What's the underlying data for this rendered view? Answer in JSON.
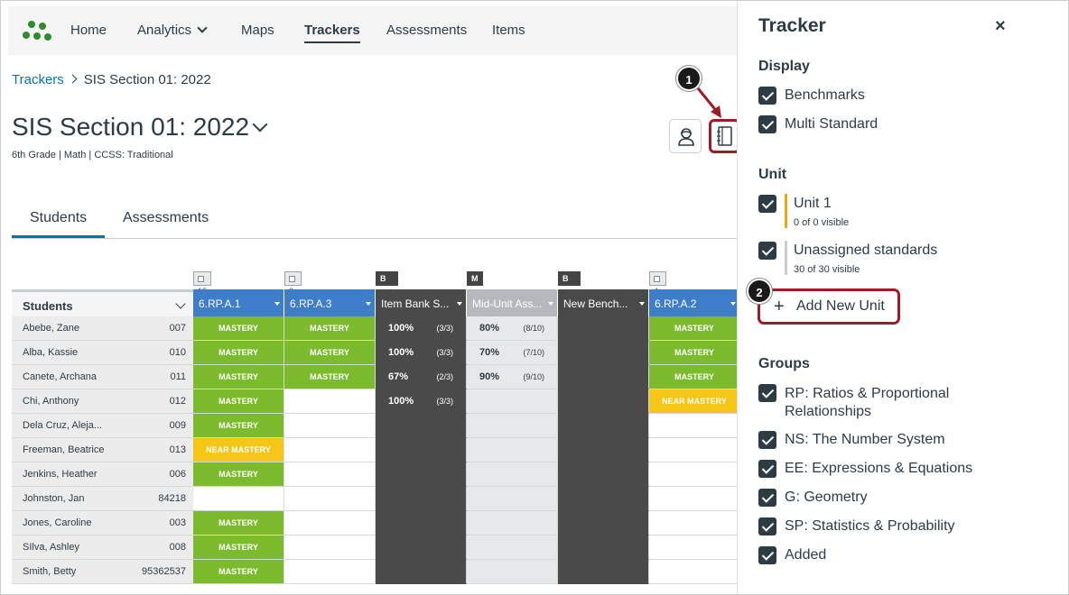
{
  "nav": {
    "items": [
      "Home",
      "Analytics",
      "Maps",
      "Trackers",
      "Assessments",
      "Items"
    ],
    "active": "Trackers"
  },
  "breadcrumb": {
    "root": "Trackers",
    "current": "SIS Section 01: 2022"
  },
  "page": {
    "title": "SIS Section 01: 2022",
    "subtitle": "6th Grade | Math | CCSS: Traditional"
  },
  "callouts": {
    "one": "1",
    "two": "2"
  },
  "tabs": [
    "Students",
    "Assessments"
  ],
  "grid": {
    "students_header": "Students",
    "tags": [
      "15",
      "3",
      "B",
      "M",
      "B",
      "4"
    ],
    "columns": [
      "6.RP.A.1",
      "6.RP.A.3",
      "Item Bank S...",
      "Mid-Unit Ass...",
      "New Bench...",
      "6.RP.A.2"
    ],
    "rows": [
      {
        "name": "Abebe, Zane",
        "id": "007",
        "c1": "MASTERY",
        "c2": "MASTERY",
        "c3": "100%",
        "c3f": "(3/3)",
        "c4": "80%",
        "c4f": "(8/10)",
        "c6": "MASTERY"
      },
      {
        "name": "Alba, Kassie",
        "id": "010",
        "c1": "MASTERY",
        "c2": "MASTERY",
        "c3": "100%",
        "c3f": "(3/3)",
        "c4": "70%",
        "c4f": "(7/10)",
        "c6": "MASTERY"
      },
      {
        "name": "Canete, Archana",
        "id": "011",
        "c1": "MASTERY",
        "c2": "MASTERY",
        "c3": "67%",
        "c3f": "(2/3)",
        "c4": "90%",
        "c4f": "(9/10)",
        "c6": "MASTERY"
      },
      {
        "name": "Chi, Anthony",
        "id": "012",
        "c1": "MASTERY",
        "c2": "",
        "c3": "100%",
        "c3f": "(3/3)",
        "c4": "",
        "c4f": "",
        "c6": "NEAR MASTERY"
      },
      {
        "name": "Dela Cruz, Aleja...",
        "id": "009",
        "c1": "MASTERY",
        "c2": "",
        "c3": "",
        "c3f": "",
        "c4": "",
        "c4f": "",
        "c6": ""
      },
      {
        "name": "Freeman, Beatrice",
        "id": "013",
        "c1": "NEAR MASTERY",
        "c2": "",
        "c3": "",
        "c3f": "",
        "c4": "",
        "c4f": "",
        "c6": ""
      },
      {
        "name": "Jenkins, Heather",
        "id": "006",
        "c1": "MASTERY",
        "c2": "",
        "c3": "",
        "c3f": "",
        "c4": "",
        "c4f": "",
        "c6": ""
      },
      {
        "name": "Johnston, Jan",
        "id": "84218",
        "c1": "",
        "c2": "",
        "c3": "",
        "c3f": "",
        "c4": "",
        "c4f": "",
        "c6": ""
      },
      {
        "name": "Jones, Caroline",
        "id": "003",
        "c1": "MASTERY",
        "c2": "",
        "c3": "",
        "c3f": "",
        "c4": "",
        "c4f": "",
        "c6": ""
      },
      {
        "name": "SIlva, Ashley",
        "id": "008",
        "c1": "MASTERY",
        "c2": "",
        "c3": "",
        "c3f": "",
        "c4": "",
        "c4f": "",
        "c6": ""
      },
      {
        "name": "Smith, Betty",
        "id": "95362537",
        "c1": "MASTERY",
        "c2": "",
        "c3": "",
        "c3f": "",
        "c4": "",
        "c4f": "",
        "c6": ""
      }
    ]
  },
  "panel": {
    "title": "Tracker",
    "close": "×",
    "display_heading": "Display",
    "display": [
      "Benchmarks",
      "Multi Standard"
    ],
    "unit_heading": "Unit",
    "units": [
      {
        "name": "Unit 1",
        "sub": "0 of 0 visible",
        "color": "#f0a30a"
      },
      {
        "name": "Unassigned standards",
        "sub": "30 of 30 visible",
        "color": "#c7cdd1"
      }
    ],
    "add_unit": "Add New Unit",
    "groups_heading": "Groups",
    "groups": [
      "RP: Ratios & Proportional Relationships",
      "NS: The Number System",
      "EE: Expressions & Equations",
      "G: Geometry",
      "SP: Statistics & Probability",
      "Added"
    ]
  },
  "colors": {
    "mastery": "#7cbb2e",
    "near_mastery": "#f5c518",
    "header_blue": "#3d7dc9",
    "callout": "#9c1d26",
    "link": "#0374b5"
  }
}
